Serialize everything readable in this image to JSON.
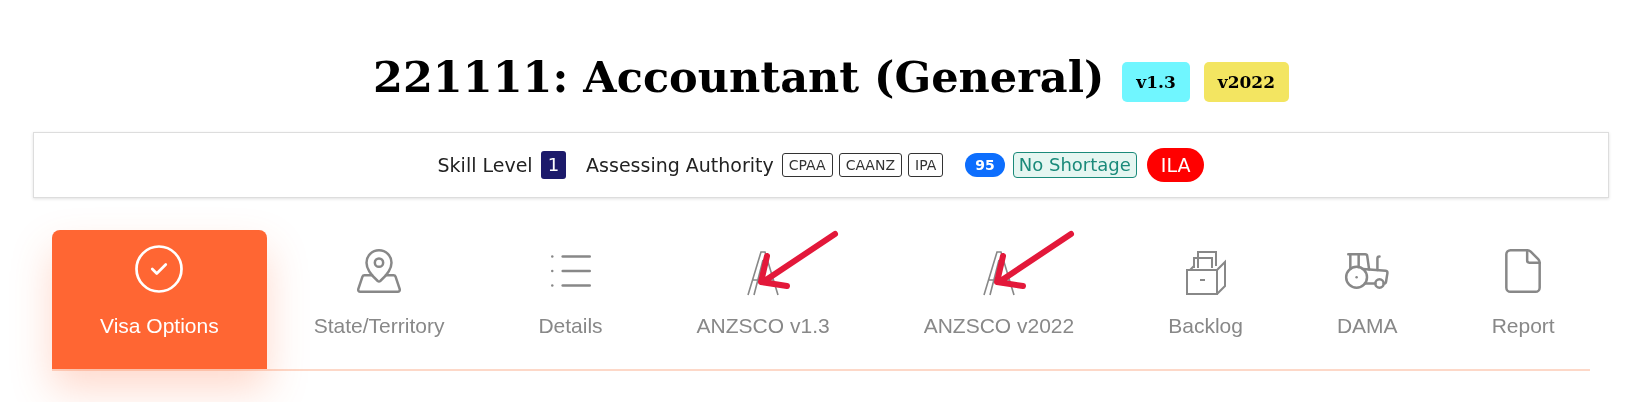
{
  "title": "221111: Accountant (General)",
  "version_badges": [
    {
      "label": "v1.3",
      "color": "#70f6ff"
    },
    {
      "label": "v2022",
      "color": "#f3e561"
    }
  ],
  "info_bar": [
    {
      "kind": "label",
      "text": "Skill Level"
    },
    {
      "kind": "level",
      "text": "1"
    },
    {
      "kind": "label",
      "text": "Assessing Authority"
    },
    {
      "kind": "authority",
      "text": "CPAA"
    },
    {
      "kind": "authority",
      "text": "CAANZ"
    },
    {
      "kind": "authority",
      "text": "IPA"
    },
    {
      "kind": "count",
      "text": "95"
    },
    {
      "kind": "status",
      "text": "No Shortage"
    },
    {
      "kind": "flag",
      "text": "ILA"
    }
  ],
  "tabs": [
    {
      "label": "Visa Options",
      "selected": true,
      "marked": false
    },
    {
      "label": "State/Territory",
      "selected": false,
      "marked": false
    },
    {
      "label": "Details",
      "selected": false,
      "marked": false
    },
    {
      "label": "ANZSCO v1.3",
      "selected": false,
      "marked": true
    },
    {
      "label": "ANZSCO v2022",
      "selected": false,
      "marked": true
    },
    {
      "label": "Backlog",
      "selected": false,
      "marked": false
    },
    {
      "label": "DAMA",
      "selected": false,
      "marked": false
    },
    {
      "label": "Report",
      "selected": false,
      "marked": false
    }
  ]
}
